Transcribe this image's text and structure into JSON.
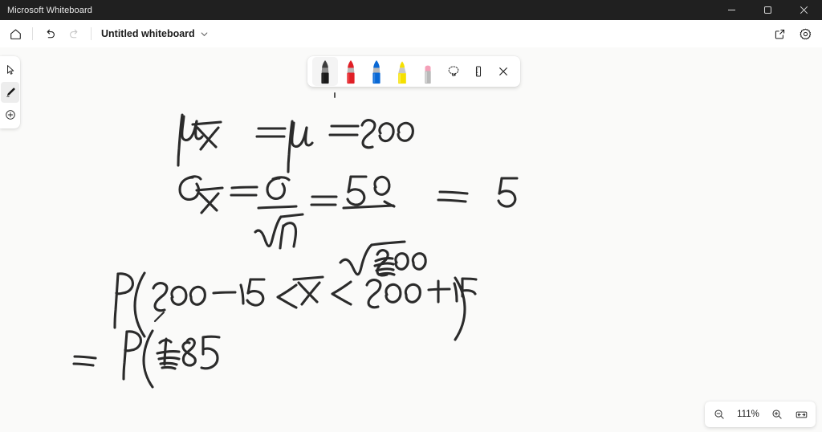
{
  "window": {
    "title": "Microsoft Whiteboard",
    "controls": {
      "minimize": "Minimize",
      "maximize": "Restore",
      "close": "Close"
    }
  },
  "commandbar": {
    "home_label": "Home",
    "undo_label": "Undo",
    "redo_label": "Redo",
    "document_title": "Untitled whiteboard",
    "title_chevron": "chevron-down",
    "share_label": "Share",
    "settings_label": "Settings"
  },
  "rail": {
    "items": [
      {
        "name": "select-tool",
        "label": "Select",
        "icon": "cursor-arrow-icon",
        "active": false
      },
      {
        "name": "pen-tool",
        "label": "Inking",
        "icon": "pen-icon",
        "active": true
      },
      {
        "name": "insert-tool",
        "label": "Insert",
        "icon": "plus-circle-icon",
        "active": false
      }
    ]
  },
  "pentoolbar": {
    "pens": [
      {
        "name": "pen-black",
        "label": "Black pen",
        "color": "#1a1a1a",
        "selected": true
      },
      {
        "name": "pen-red",
        "label": "Red pen",
        "color": "#e01f26",
        "selected": false
      },
      {
        "name": "pen-blue",
        "label": "Blue pen",
        "color": "#0a68d4",
        "selected": false
      },
      {
        "name": "highlighter-yellow",
        "label": "Yellow highlighter",
        "color": "#f5e000",
        "selected": false
      },
      {
        "name": "eraser",
        "label": "Eraser",
        "color": "#b9b9b9",
        "cap_color": "#f4a0b8",
        "selected": false
      }
    ],
    "tools": [
      {
        "name": "lasso-select",
        "label": "Lasso select",
        "icon": "lasso-icon"
      },
      {
        "name": "ruler",
        "label": "Ruler",
        "icon": "ruler-icon"
      },
      {
        "name": "close-toolbar",
        "label": "Close",
        "icon": "close-icon"
      }
    ]
  },
  "zoom": {
    "out_label": "Zoom out",
    "level": "111%",
    "in_label": "Zoom in",
    "fit_label": "Fit to screen"
  },
  "ink_content": {
    "description": "Handwritten statistics work shown in black ink on the whiteboard canvas",
    "lines": [
      {
        "id": "line-1",
        "text": "μ X̄ = μ = 200"
      },
      {
        "id": "line-2",
        "text": "σ X̄ = σ / √n = 50 / √100 = 5"
      },
      {
        "id": "line-3",
        "text": "P( 200 − 15 < X̄ < 200 + 15 )"
      },
      {
        "id": "line-4",
        "text": "= P( 185"
      }
    ]
  }
}
